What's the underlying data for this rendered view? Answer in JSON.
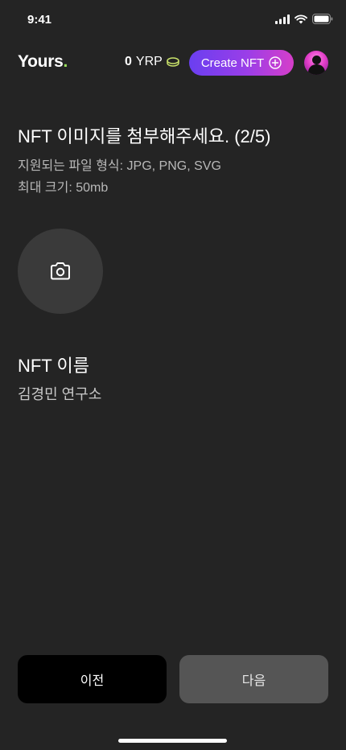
{
  "status_bar": {
    "time": "9:41"
  },
  "header": {
    "logo_text": "Yours",
    "logo_dot": ".",
    "balance_value": "0",
    "balance_unit": "YRP",
    "create_label": "Create NFT"
  },
  "upload_section": {
    "title": "NFT 이미지를 첨부해주세요. (2/5)",
    "formats": "지원되는 파일 형식: JPG, PNG, SVG",
    "max_size": "최대 크기: 50mb"
  },
  "name_section": {
    "label": "NFT 이름",
    "value": "김경민 연구소"
  },
  "footer": {
    "prev_label": "이전",
    "next_label": "다음"
  },
  "colors": {
    "background": "#242424",
    "accent_green": "#9be15d",
    "gradient_start": "#6a3ff0",
    "gradient_end": "#d63ec9"
  },
  "icons": [
    "signal-icon",
    "wifi-icon",
    "battery-icon",
    "coin-icon",
    "plus-circle-icon",
    "camera-icon"
  ]
}
